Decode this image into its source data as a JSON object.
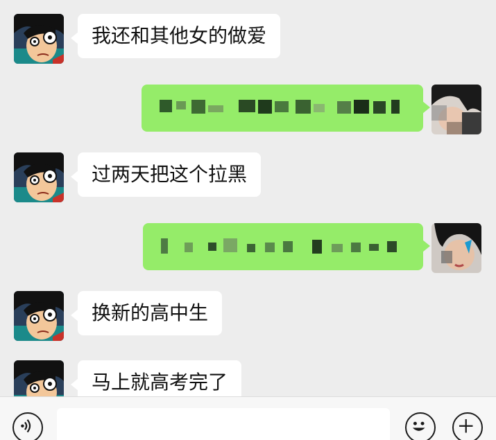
{
  "messages": [
    {
      "side": "left",
      "text": "我还和其他女的做爱"
    },
    {
      "side": "right",
      "text": ""
    },
    {
      "side": "left",
      "text": "过两天把这个拉黑"
    },
    {
      "side": "right",
      "text": ""
    },
    {
      "side": "left",
      "text": "换新的高中生"
    },
    {
      "side": "left",
      "text": "马上就高考完了"
    }
  ],
  "toolbar": {
    "voice_icon": "voice-icon",
    "emoji_icon": "emoji-icon",
    "plus_icon": "plus-icon",
    "input_value": ""
  },
  "colors": {
    "background": "#ededed",
    "incoming_bubble": "#ffffff",
    "outgoing_bubble": "#95ec69"
  }
}
